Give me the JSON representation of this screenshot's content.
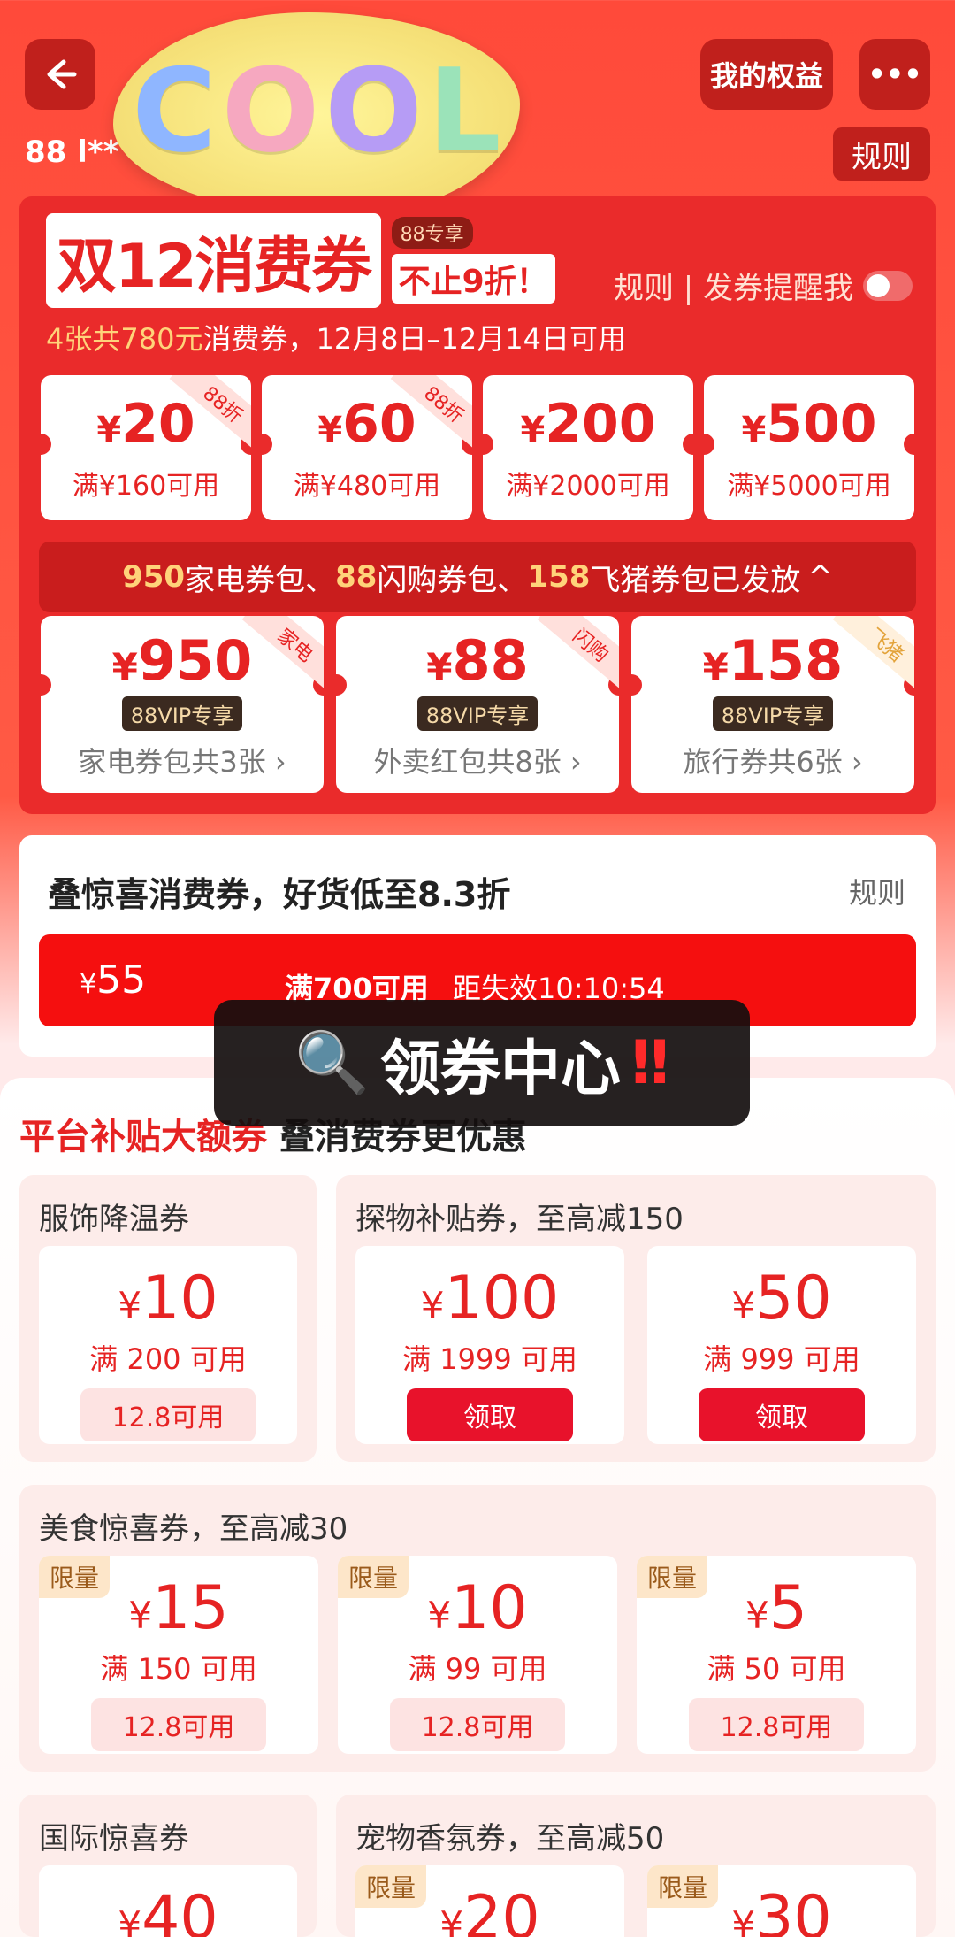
{
  "topbar": {
    "user_prefix": "88",
    "user_name": "l**",
    "my_rights": "我的权益",
    "more": "•••",
    "rules": "规则"
  },
  "sticker": {
    "text": "COOL"
  },
  "d12": {
    "title": "双12消费券",
    "badge": "88专享",
    "sub_title": "不止9折！",
    "rule_link": "规则 | 发券提醒我",
    "summary_hl": "4张共780元",
    "summary_rest": "消费券，12月8日–12月14日可用",
    "coupons": [
      {
        "amount": "20",
        "cond": "满¥160可用",
        "tag": "88折"
      },
      {
        "amount": "60",
        "cond": "满¥480可用",
        "tag": "88折"
      },
      {
        "amount": "200",
        "cond": "满¥2000可用",
        "tag": ""
      },
      {
        "amount": "500",
        "cond": "满¥5000可用",
        "tag": ""
      }
    ],
    "release": {
      "n1": "950",
      "t1": "家电券包、",
      "n2": "88",
      "t2": "闪购券包、",
      "n3": "158",
      "t3": "飞猪券包已发放",
      "chevron": "^"
    },
    "packs": [
      {
        "amount": "950",
        "vip": "88VIP专享",
        "desc": "家电券包共3张 ›",
        "tag": "家电"
      },
      {
        "amount": "88",
        "vip": "88VIP专享",
        "desc": "外卖红包共8张 ›",
        "tag": "闪购"
      },
      {
        "amount": "158",
        "vip": "88VIP专享",
        "desc": "旅行券共6张 ›",
        "tag": "飞猪"
      }
    ]
  },
  "stack": {
    "title": "叠惊喜消费券，好货低至8.3折",
    "rule": "规则",
    "amount": "55",
    "cond": "满700可用",
    "countdown": "距失效10:10:54"
  },
  "overlay": {
    "icon": "🔍",
    "text": "领券中心",
    "bang": "‼"
  },
  "sheet": {
    "title_red": "平台补贴大额券",
    "title_rest": "叠消费券更优惠",
    "groups": [
      {
        "title": "服饰降温券",
        "cards": [
          {
            "amount": "10",
            "cond": "满 200 可用",
            "btn": "12.8可用"
          }
        ]
      },
      {
        "title": "探物补贴券，至高减150",
        "cards": [
          {
            "amount": "100",
            "cond": "满 1999 可用",
            "btn": "领取"
          },
          {
            "amount": "50",
            "cond": "满 999 可用",
            "btn": "领取"
          }
        ]
      },
      {
        "title": "美食惊喜券，至高减30",
        "cards": [
          {
            "amount": "15",
            "cond": "满 150 可用",
            "btn": "12.8可用",
            "tag": "限量"
          },
          {
            "amount": "10",
            "cond": "满 99 可用",
            "btn": "12.8可用",
            "tag": "限量"
          },
          {
            "amount": "5",
            "cond": "满 50 可用",
            "btn": "12.8可用",
            "tag": "限量"
          }
        ]
      },
      {
        "title": "国际惊喜券",
        "cards": [
          {
            "amount": "40"
          }
        ]
      },
      {
        "title": "宠物香氛券，至高减50",
        "cards": [
          {
            "amount": "20",
            "tag": "限量"
          },
          {
            "amount": "30",
            "tag": "限量"
          }
        ]
      }
    ]
  },
  "currency": "¥",
  "colors": {
    "brand_red": "#e62323",
    "panel_red": "#ea2b2b",
    "gold": "#ffd37a"
  }
}
